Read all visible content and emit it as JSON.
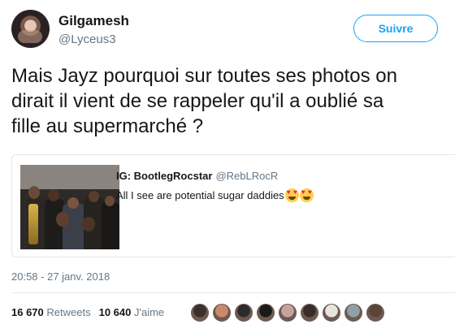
{
  "user": {
    "name": "Gilgamesh",
    "handle": "@Lyceus3",
    "avatar_icon": "profile-avatar"
  },
  "follow_button": {
    "label": "Suivre",
    "color": "#1da1f2"
  },
  "tweet": {
    "lines": [
      "Mais Jayz pourquoi sur toutes ses photos on",
      "dirait il vient de se rappeler qu'il a oublié sa",
      "fille au supermarché ?"
    ]
  },
  "quoted_tweet": {
    "name": "IG: BootlegRocstar",
    "handle": "@RebLRocR",
    "text": "All I see are potential sugar daddies",
    "emojis": [
      "heart-eyes-emoji",
      "heart-eyes-emoji"
    ],
    "image_icon": "group-photo"
  },
  "timestamp": "20:58 - 27 janv. 2018",
  "stats": {
    "retweets_count": "16 670",
    "retweets_label": "Retweets",
    "likes_count": "10 640",
    "likes_label": "J'aime"
  },
  "likers": {
    "colors": [
      "#3b2f2a",
      "#c98a6a",
      "#2b2b2b",
      "#1a1a1a",
      "#c7a3a0",
      "#3a2c28",
      "#e8e4e0",
      "#8fa0a8",
      "#5a4638"
    ]
  }
}
